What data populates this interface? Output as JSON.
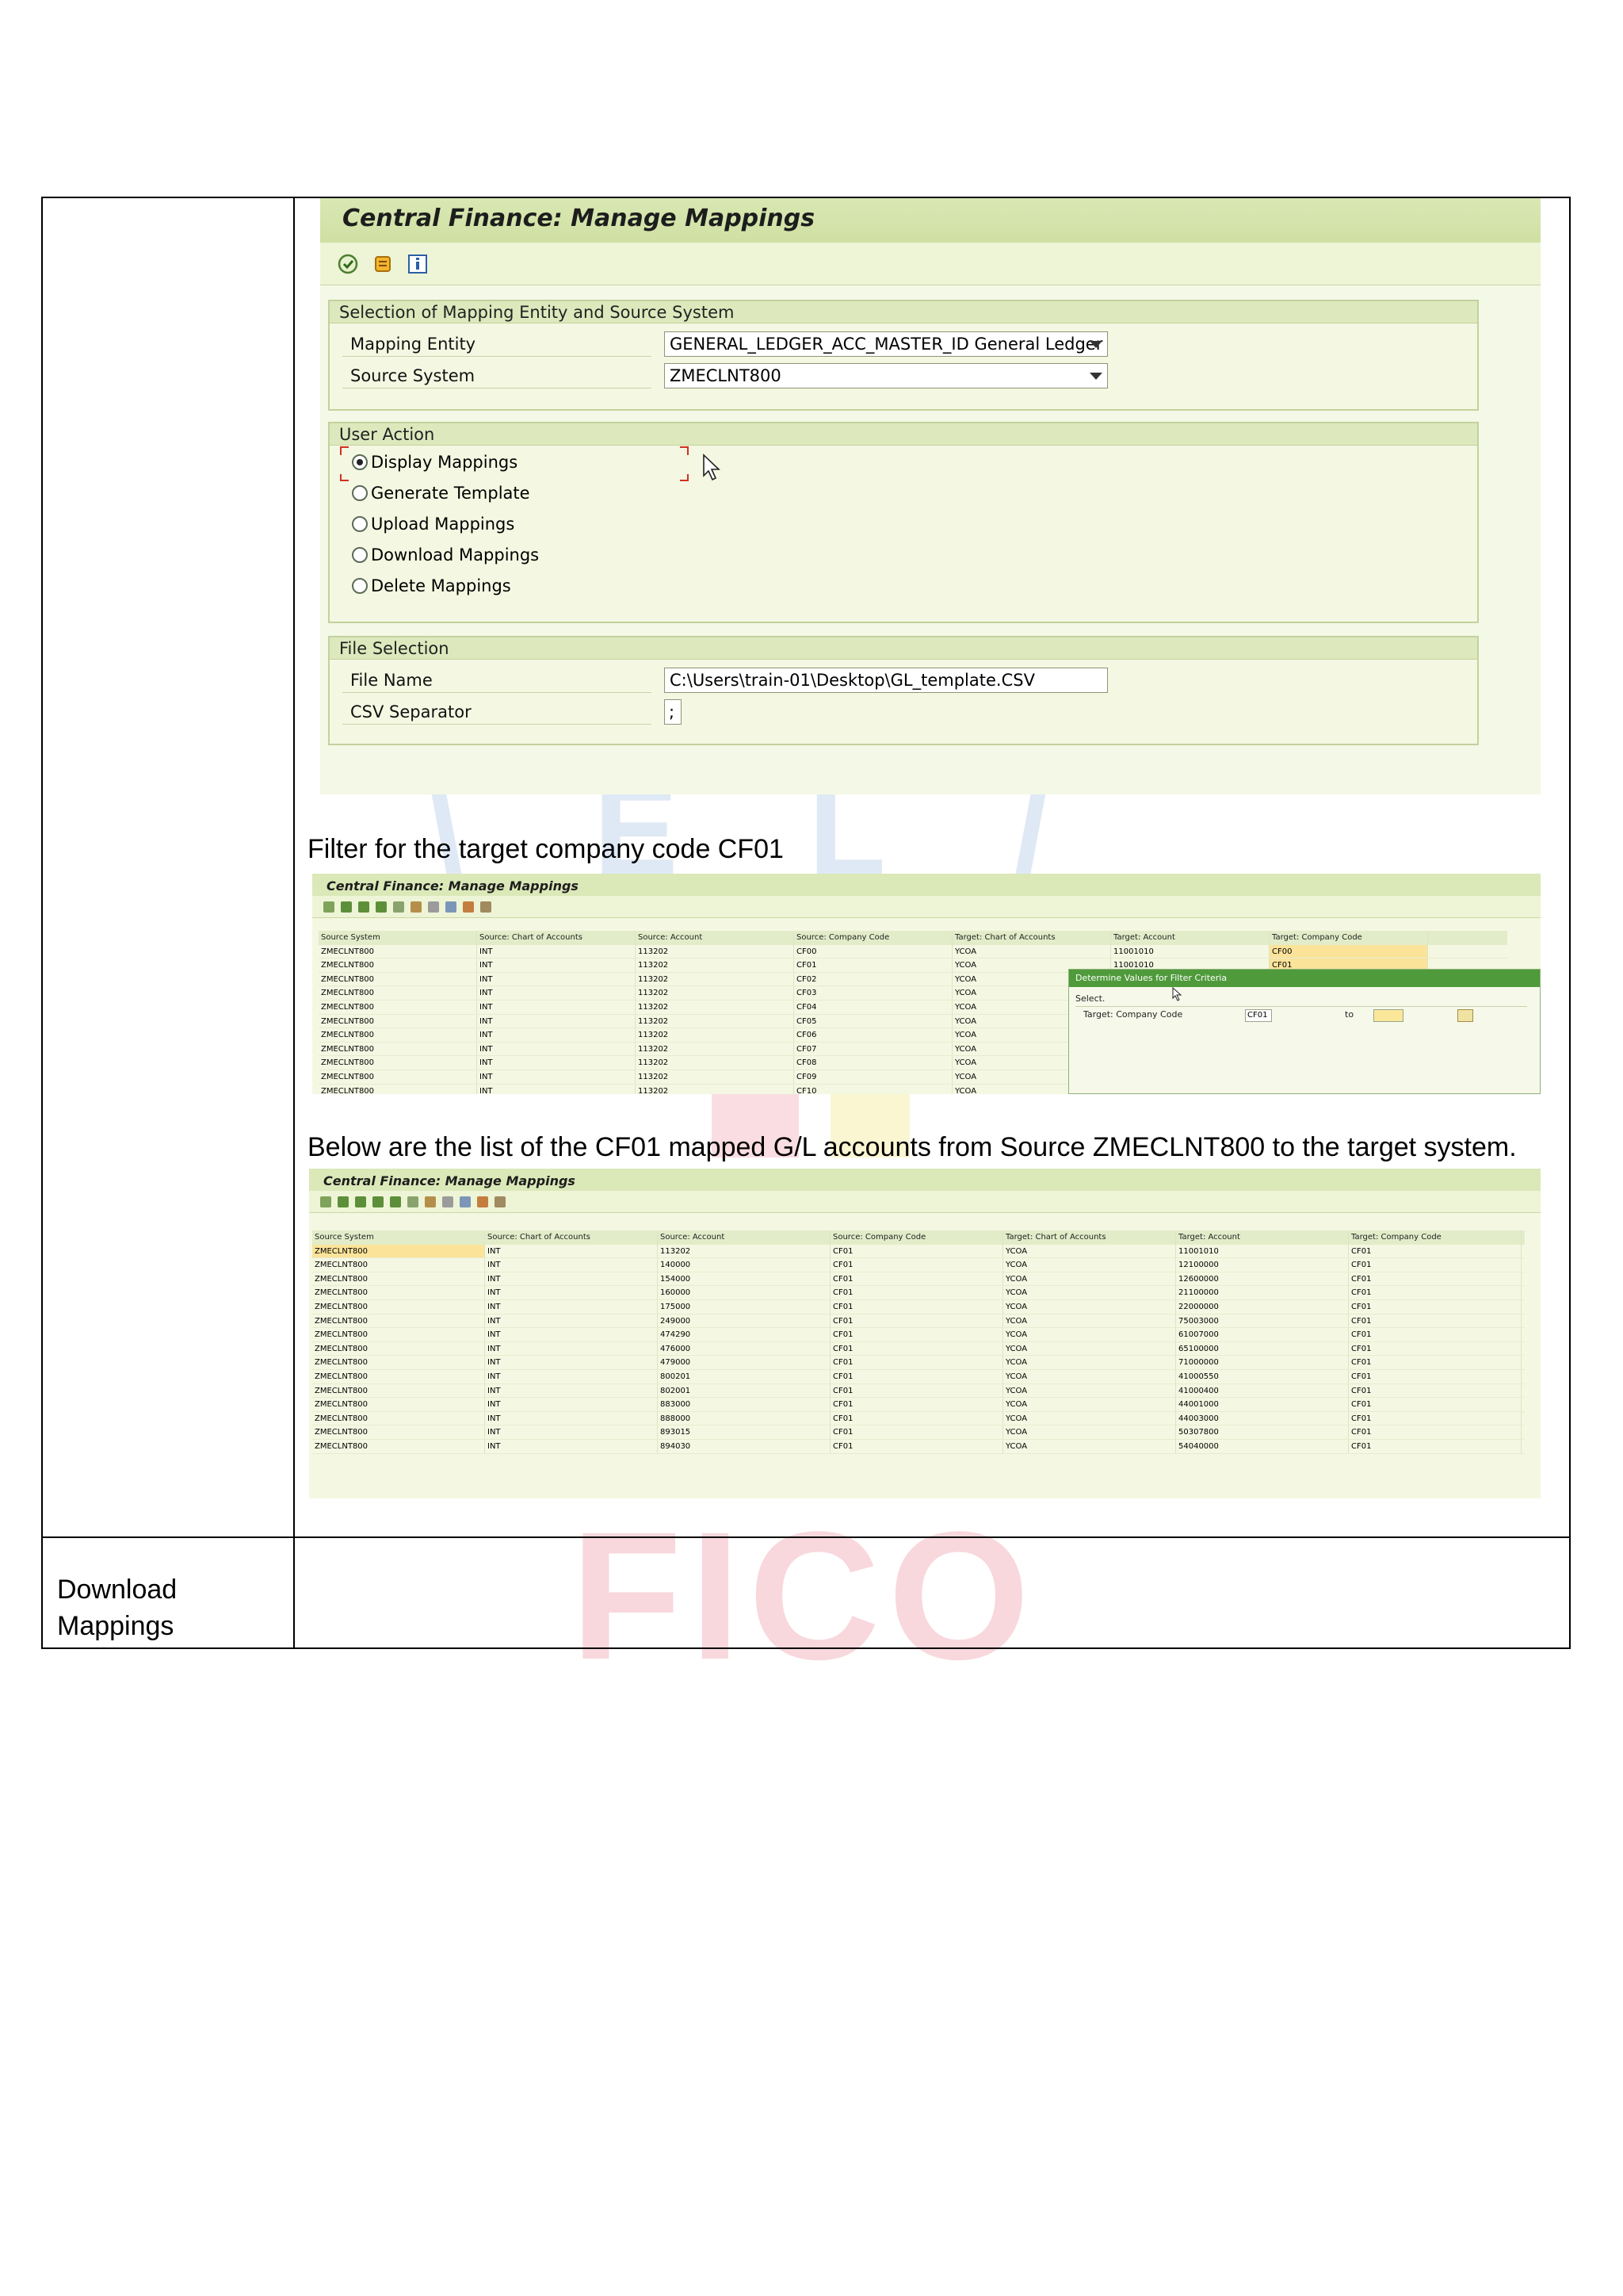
{
  "document": {
    "left_label": "Download Mappings",
    "caption_filter": "Filter for the target company code CF01",
    "caption_list": "Below are the list of the CF01 mapped G/L accounts from Source ZMECLNT800 to the target system.",
    "watermark": "FICO"
  },
  "screen1": {
    "title": "Central Finance: Manage Mappings",
    "toolbar_icons": [
      "execute-icon",
      "scroll-icon",
      "info-icon"
    ],
    "selection_group": {
      "header": "Selection of Mapping Entity and Source System",
      "mapping_entity_label": "Mapping Entity",
      "mapping_entity_value": "GENERAL_LEDGER_ACC_MASTER_ID General Ledger ...",
      "source_system_label": "Source System",
      "source_system_value": "ZMECLNT800"
    },
    "user_action_group": {
      "header": "User Action",
      "options": [
        "Display Mappings",
        "Generate Template",
        "Upload Mappings",
        "Download Mappings",
        "Delete Mappings"
      ],
      "selected_index": 0
    },
    "file_group": {
      "header": "File Selection",
      "file_name_label": "File Name",
      "file_name_value": "C:\\Users\\train-01\\Desktop\\GL_template.CSV",
      "csv_label": "CSV Separator",
      "csv_value": ";"
    }
  },
  "screen2": {
    "title": "Central Finance: Manage Mappings",
    "columns": [
      "Source System",
      "Source: Chart of Accounts",
      "Source: Account",
      "Source: Company Code",
      "Target: Chart of Accounts",
      "Target: Account",
      "Target: Company Code"
    ],
    "rows": [
      [
        "ZMECLNT800",
        "INT",
        "113202",
        "CF00",
        "YCOA",
        "11001010",
        "CF00"
      ],
      [
        "ZMECLNT800",
        "INT",
        "113202",
        "CF01",
        "YCOA",
        "11001010",
        "CF01"
      ],
      [
        "ZMECLNT800",
        "INT",
        "113202",
        "CF02",
        "YCOA",
        "",
        ""
      ],
      [
        "ZMECLNT800",
        "INT",
        "113202",
        "CF03",
        "YCOA",
        "",
        ""
      ],
      [
        "ZMECLNT800",
        "INT",
        "113202",
        "CF04",
        "YCOA",
        "",
        ""
      ],
      [
        "ZMECLNT800",
        "INT",
        "113202",
        "CF05",
        "YCOA",
        "",
        ""
      ],
      [
        "ZMECLNT800",
        "INT",
        "113202",
        "CF06",
        "YCOA",
        "",
        ""
      ],
      [
        "ZMECLNT800",
        "INT",
        "113202",
        "CF07",
        "YCOA",
        "",
        ""
      ],
      [
        "ZMECLNT800",
        "INT",
        "113202",
        "CF08",
        "YCOA",
        "",
        ""
      ],
      [
        "ZMECLNT800",
        "INT",
        "113202",
        "CF09",
        "YCOA",
        "",
        ""
      ],
      [
        "ZMECLNT800",
        "INT",
        "113202",
        "CF10",
        "YCOA",
        "",
        ""
      ]
    ],
    "popup": {
      "title": "Determine Values for Filter Criteria",
      "select_label": "Select.",
      "field_label": "Target: Company Code",
      "from_value": "CF01",
      "to_label": "to",
      "to_value": ""
    }
  },
  "screen3": {
    "title": "Central Finance: Manage Mappings",
    "columns": [
      "Source System",
      "Source: Chart of Accounts",
      "Source: Account",
      "Source: Company Code",
      "Target: Chart of Accounts",
      "Target: Account",
      "Target: Company Code"
    ],
    "rows": [
      [
        "ZMECLNT800",
        "INT",
        "113202",
        "CF01",
        "YCOA",
        "11001010",
        "CF01"
      ],
      [
        "ZMECLNT800",
        "INT",
        "140000",
        "CF01",
        "YCOA",
        "12100000",
        "CF01"
      ],
      [
        "ZMECLNT800",
        "INT",
        "154000",
        "CF01",
        "YCOA",
        "12600000",
        "CF01"
      ],
      [
        "ZMECLNT800",
        "INT",
        "160000",
        "CF01",
        "YCOA",
        "21100000",
        "CF01"
      ],
      [
        "ZMECLNT800",
        "INT",
        "175000",
        "CF01",
        "YCOA",
        "22000000",
        "CF01"
      ],
      [
        "ZMECLNT800",
        "INT",
        "249000",
        "CF01",
        "YCOA",
        "75003000",
        "CF01"
      ],
      [
        "ZMECLNT800",
        "INT",
        "474290",
        "CF01",
        "YCOA",
        "61007000",
        "CF01"
      ],
      [
        "ZMECLNT800",
        "INT",
        "476000",
        "CF01",
        "YCOA",
        "65100000",
        "CF01"
      ],
      [
        "ZMECLNT800",
        "INT",
        "479000",
        "CF01",
        "YCOA",
        "71000000",
        "CF01"
      ],
      [
        "ZMECLNT800",
        "INT",
        "800201",
        "CF01",
        "YCOA",
        "41000550",
        "CF01"
      ],
      [
        "ZMECLNT800",
        "INT",
        "802001",
        "CF01",
        "YCOA",
        "41000400",
        "CF01"
      ],
      [
        "ZMECLNT800",
        "INT",
        "883000",
        "CF01",
        "YCOA",
        "44001000",
        "CF01"
      ],
      [
        "ZMECLNT800",
        "INT",
        "888000",
        "CF01",
        "YCOA",
        "44003000",
        "CF01"
      ],
      [
        "ZMECLNT800",
        "INT",
        "893015",
        "CF01",
        "YCOA",
        "50307800",
        "CF01"
      ],
      [
        "ZMECLNT800",
        "INT",
        "894030",
        "CF01",
        "YCOA",
        "54040000",
        "CF01"
      ]
    ]
  }
}
